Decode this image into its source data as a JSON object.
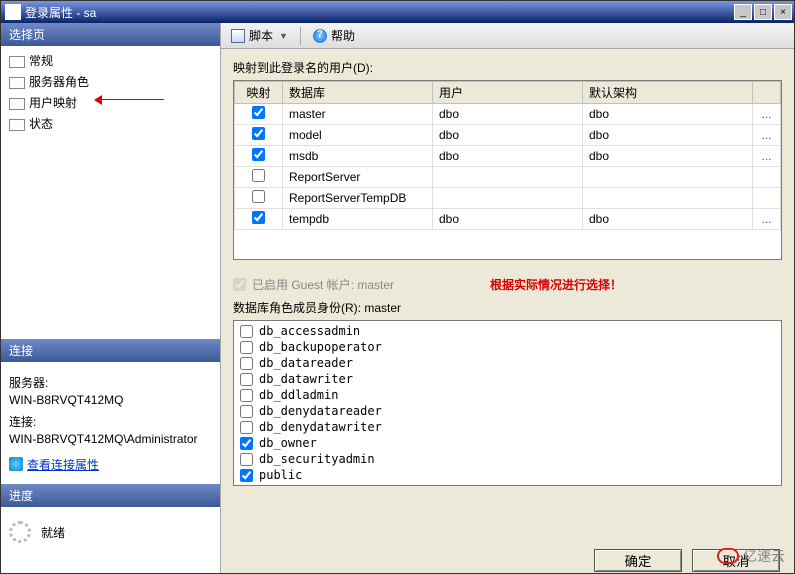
{
  "window": {
    "title": "登录属性 - sa"
  },
  "sidebar": {
    "select_page_header": "选择页",
    "nav": [
      {
        "label": "常规"
      },
      {
        "label": "服务器角色"
      },
      {
        "label": "用户映射",
        "selected": true
      },
      {
        "label": "状态"
      }
    ],
    "connection_header": "连接",
    "server_label": "服务器:",
    "server_value": "WIN-B8RVQT412MQ",
    "conn_label": "连接:",
    "conn_value": "WIN-B8RVQT412MQ\\Administrator",
    "view_conn_props": "查看连接属性",
    "progress_header": "进度",
    "progress_status": "就绪"
  },
  "toolbar": {
    "script_label": "脚本",
    "help_label": "帮助"
  },
  "main": {
    "mapped_users_label": "映射到此登录名的用户(D):",
    "columns": {
      "map": "映射",
      "database": "数据库",
      "user": "用户",
      "schema": "默认架构"
    },
    "rows": [
      {
        "checked": true,
        "database": "master",
        "user": "dbo",
        "schema": "dbo",
        "ellipsis": true
      },
      {
        "checked": true,
        "database": "model",
        "user": "dbo",
        "schema": "dbo",
        "ellipsis": true
      },
      {
        "checked": true,
        "database": "msdb",
        "user": "dbo",
        "schema": "dbo",
        "ellipsis": true
      },
      {
        "checked": false,
        "database": "ReportServer",
        "user": "",
        "schema": "",
        "ellipsis": false
      },
      {
        "checked": false,
        "database": "ReportServerTempDB",
        "user": "",
        "schema": "",
        "ellipsis": false
      },
      {
        "checked": true,
        "database": "tempdb",
        "user": "dbo",
        "schema": "dbo",
        "ellipsis": true
      }
    ],
    "guest_checked": true,
    "guest_label": "已启用 Guest 帐户: master",
    "note_red": "根据实际情况进行选择！",
    "roles_label": "数据库角色成员身份(R): master",
    "roles": [
      {
        "checked": false,
        "name": "db_accessadmin"
      },
      {
        "checked": false,
        "name": "db_backupoperator"
      },
      {
        "checked": false,
        "name": "db_datareader"
      },
      {
        "checked": false,
        "name": "db_datawriter"
      },
      {
        "checked": false,
        "name": "db_ddladmin"
      },
      {
        "checked": false,
        "name": "db_denydatareader"
      },
      {
        "checked": false,
        "name": "db_denydatawriter"
      },
      {
        "checked": true,
        "name": "db_owner"
      },
      {
        "checked": false,
        "name": "db_securityadmin"
      },
      {
        "checked": true,
        "name": "public"
      }
    ]
  },
  "footer": {
    "ok": "确定",
    "cancel": "取消"
  },
  "watermark": "亿速云"
}
